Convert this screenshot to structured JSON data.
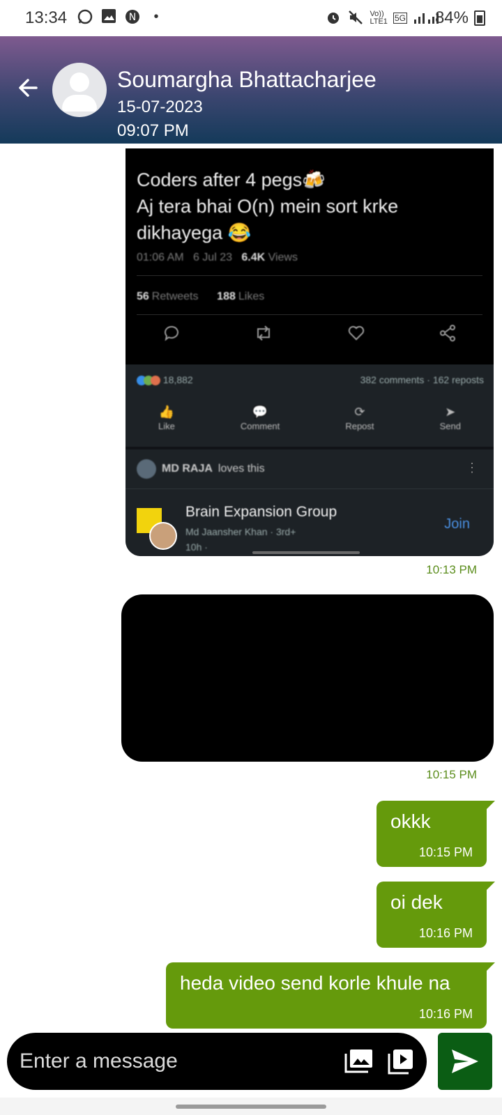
{
  "status_bar": {
    "time": "13:34",
    "battery": "84%",
    "net_top": "Vo))",
    "net_bottom": "LTE1",
    "gen": "5G",
    "icons": [
      "whatsapp-icon",
      "gallery-icon",
      "app-icon",
      "dot-icon",
      "alarm-icon",
      "mute-icon",
      "signal-icon",
      "battery-icon"
    ]
  },
  "header": {
    "contact_name": "Soumargha Bhattacharjee",
    "date": "15-07-2023",
    "time": "09:07 PM"
  },
  "messages": [
    {
      "type": "image",
      "direction": "incoming",
      "time": "10:13 PM",
      "content": {
        "tweet_text": "Coders after 4 pegs🍻\nAj tera bhai O(n) mein sort krke dikhayega 😂",
        "tweet_time": "01:06 AM",
        "tweet_date": "6 Jul 23",
        "views_count": "6.4K",
        "views_label": "Views",
        "retweets_count": "56",
        "retweets_label": "Retweets",
        "likes_count": "188",
        "likes_label": "Likes",
        "reactions_count": "18,882",
        "comments_reposts": "382 comments · 162 reposts",
        "actions": [
          "Like",
          "Comment",
          "Repost",
          "Send"
        ],
        "loves_name": "MD RAJA",
        "loves_text": "loves this",
        "group_name": "Brain Expansion Group",
        "group_sub": "Md Jaansher Khan · 3rd+",
        "group_age": "10h ·",
        "join_label": "Join"
      }
    },
    {
      "type": "image",
      "direction": "incoming",
      "time": "10:15 PM"
    },
    {
      "type": "text",
      "direction": "outgoing",
      "text": "okkk",
      "time": "10:15 PM"
    },
    {
      "type": "text",
      "direction": "outgoing",
      "text": "oi dek",
      "time": "10:16 PM"
    },
    {
      "type": "text",
      "direction": "outgoing",
      "text": "heda video send korle khule na",
      "time": "10:16 PM"
    }
  ],
  "composer": {
    "placeholder": "Enter a message"
  },
  "colors": {
    "outgoing_bubble": "#659a0c",
    "timestamp": "#5b8d1c",
    "send_button": "#0b5d14",
    "header_gradient_top": "#7e5a8f",
    "header_gradient_bottom": "#143a5a"
  }
}
